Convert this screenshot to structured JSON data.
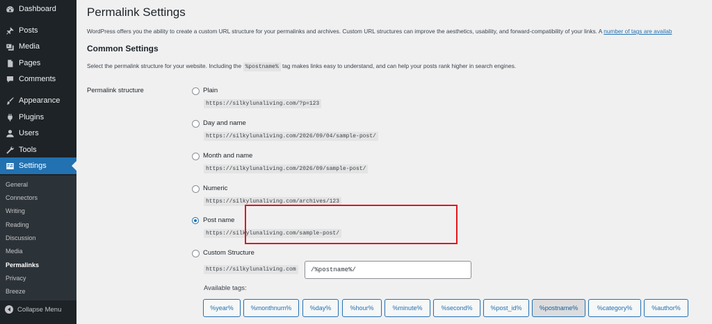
{
  "sidebar": {
    "items": [
      {
        "label": "Dashboard",
        "icon": "dashboard-icon"
      },
      {
        "label": "Posts",
        "icon": "pushpin-icon"
      },
      {
        "label": "Media",
        "icon": "media-icon"
      },
      {
        "label": "Pages",
        "icon": "page-icon"
      },
      {
        "label": "Comments",
        "icon": "comment-icon"
      },
      {
        "label": "Appearance",
        "icon": "brush-icon"
      },
      {
        "label": "Plugins",
        "icon": "plug-icon"
      },
      {
        "label": "Users",
        "icon": "user-icon"
      },
      {
        "label": "Tools",
        "icon": "wrench-icon"
      },
      {
        "label": "Settings",
        "icon": "settings-icon"
      }
    ],
    "submenu": [
      "General",
      "Connectors",
      "Writing",
      "Reading",
      "Discussion",
      "Media",
      "Permalinks",
      "Privacy",
      "Breeze"
    ],
    "collapse_label": "Collapse Menu",
    "active_color": "#2271b1"
  },
  "page": {
    "title": "Permalink Settings",
    "intro": "WordPress offers you the ability to create a custom URL structure for your permalinks and archives. Custom URL structures can improve the aesthetics, usability, and forward-compatibility of your links. A",
    "intro_link": "number of tags are availab",
    "section_title": "Common Settings",
    "section_desc_before": "Select the permalink structure for your website. Including the",
    "section_desc_code": "%postname%",
    "section_desc_after": "tag makes links easy to understand, and can help your posts rank higher in search engines.",
    "structure_label": "Permalink structure"
  },
  "options": [
    {
      "label": "Plain",
      "url": "https://silkylunaliving.com/?p=123"
    },
    {
      "label": "Day and name",
      "url": "https://silkylunaliving.com/2026/09/04/sample-post/"
    },
    {
      "label": "Month and name",
      "url": "https://silkylunaliving.com/2026/09/sample-post/"
    },
    {
      "label": "Numeric",
      "url": "https://silkylunaliving.com/archives/123"
    },
    {
      "label": "Post name",
      "url": "https://silkylunaliving.com/sample-post/"
    }
  ],
  "selected_option": "Post name",
  "custom": {
    "label": "Custom Structure",
    "base": "https://silkylunaliving.com",
    "value": "/%postname%/",
    "available_tags_label": "Available tags:"
  },
  "tags": [
    "%year%",
    "%monthnum%",
    "%day%",
    "%hour%",
    "%minute%",
    "%second%",
    "%post_id%",
    "%postname%",
    "%category%",
    "%author%"
  ],
  "pressed_tag": "%postname%",
  "highlight_color": "#e0151b"
}
